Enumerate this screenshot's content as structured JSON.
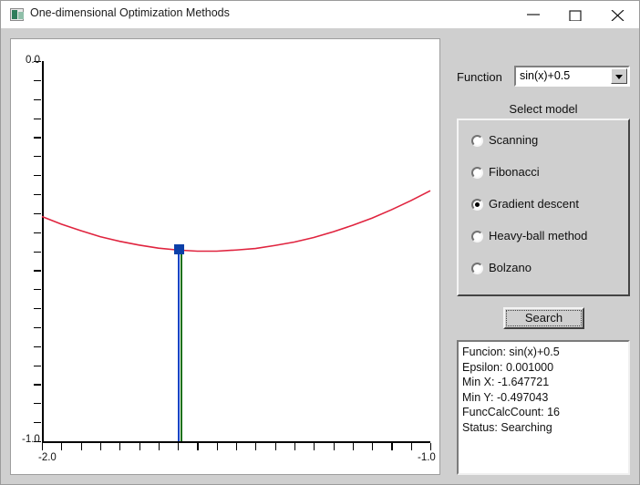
{
  "window": {
    "title": "One-dimensional Optimization Methods",
    "icon": "app-icon",
    "controls": {
      "minimize": "minimize-icon",
      "maximize": "maximize-icon",
      "close": "close-icon"
    }
  },
  "function_row": {
    "label": "Function",
    "selected": "sin(x)+0.5",
    "options": [
      "sin(x)+0.5"
    ]
  },
  "group": {
    "title": "Select model",
    "items": [
      {
        "label": "Scanning",
        "selected": false
      },
      {
        "label": "Fibonacci",
        "selected": false
      },
      {
        "label": "Gradient descent",
        "selected": true
      },
      {
        "label": "Heavy-ball method",
        "selected": false
      },
      {
        "label": "Bolzano",
        "selected": false
      }
    ]
  },
  "search_button": {
    "label": "Search"
  },
  "results": {
    "lines": [
      "Funcion: sin(x)+0.5",
      "Epsilon: 0.001000",
      "Min X: -1.647721",
      "Min Y: -0.497043",
      "FuncCalcCount: 16",
      "Status: Searching"
    ]
  },
  "chart_data": {
    "type": "line",
    "title": "",
    "xlabel": "",
    "ylabel": "",
    "xlim": [
      -2.0,
      -1.0
    ],
    "ylim": [
      -1.0,
      0.0
    ],
    "xticks": [
      -2.0,
      -1.0
    ],
    "yticks": [
      0.0,
      -1.0
    ],
    "xtick_labels": [
      "-2.0",
      "-1.0"
    ],
    "ytick_labels": [
      "0.0",
      "-1.0"
    ],
    "x_minor_tick_count": 20,
    "y_minor_tick_count": 20,
    "grid": false,
    "legend": "none",
    "curve_color": "#e0243f",
    "marker_color": "#0b3fa8",
    "vline_colors": [
      "#1144c4",
      "#147014"
    ],
    "series": [
      {
        "name": "sin(x)+0.5",
        "x": [
          -2.0,
          -1.95,
          -1.9,
          -1.85,
          -1.8,
          -1.75,
          -1.7,
          -1.65,
          -1.6,
          -1.55,
          -1.5,
          -1.45,
          -1.4,
          -1.35,
          -1.3,
          -1.25,
          -1.2,
          -1.15,
          -1.1,
          -1.05,
          -1.0
        ],
        "y": [
          -0.409,
          -0.429,
          -0.446,
          -0.462,
          -0.474,
          -0.484,
          -0.492,
          -0.497,
          -0.5,
          -0.5,
          -0.497,
          -0.493,
          -0.485,
          -0.476,
          -0.464,
          -0.449,
          -0.432,
          -0.413,
          -0.391,
          -0.367,
          -0.341
        ]
      }
    ],
    "markers": [
      {
        "name": "current-minimum",
        "x": -1.647721,
        "y": -0.497043
      }
    ]
  }
}
